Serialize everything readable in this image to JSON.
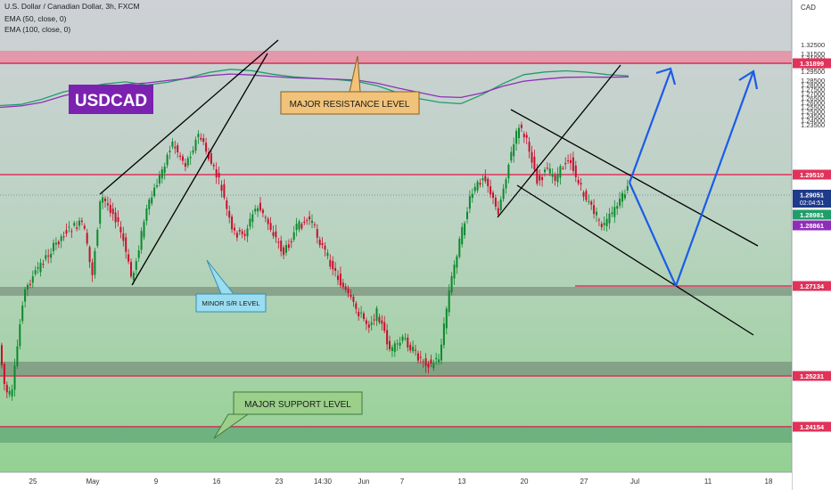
{
  "header": {
    "symbol_line": "U.S. Dollar / Canadian Dollar, 3h, FXCM",
    "ema50_line": "EMA (50, close, 0)",
    "ema100_line": "EMA (100, close, 0)",
    "currency": "CAD"
  },
  "colors": {
    "background_top": "#ced1d6",
    "background_bottom": "#93d192",
    "candle_up": "#0b8a2c",
    "candle_down": "#c8102e",
    "ema50": "#1f9e6a",
    "ema100": "#8e2eb8",
    "resistance": "#e0335a",
    "support_zone": "#6b7b6b",
    "projection": "#1a5ce8",
    "title_badge": "#7b22b0"
  },
  "chart_data": {
    "type": "candlestick",
    "title": "USDCAD",
    "price_axis": {
      "min": 1.2325,
      "max": 1.3325,
      "ticks": [
        "1.32500",
        "1.31500",
        "1.31000",
        "1.30500",
        "1.30000",
        "1.29500",
        "1.28500",
        "1.28000",
        "1.27500",
        "1.27000",
        "1.26500",
        "1.26000",
        "1.25500",
        "1.25000",
        "1.24500",
        "1.24000",
        "1.23500"
      ]
    },
    "time_axis": {
      "ticks": [
        "25",
        "May",
        "9",
        "16",
        "23",
        "14:30",
        "Jun",
        "7",
        "13",
        "20",
        "27",
        "Jul",
        "11",
        "18"
      ]
    },
    "price_labels": [
      {
        "label": "1.31899",
        "kind": "level"
      },
      {
        "label": "1.29510",
        "kind": "level"
      },
      {
        "label": "1.29051",
        "kind": "current",
        "sub": "02:04:51"
      },
      {
        "label": "1.28981",
        "kind": "ema50"
      },
      {
        "label": "1.28861",
        "kind": "ema100"
      },
      {
        "label": "1.27134",
        "kind": "level"
      },
      {
        "label": "1.25231",
        "kind": "level"
      },
      {
        "label": "1.24154",
        "kind": "level"
      }
    ],
    "series": [
      {
        "name": "EMA (50, close, 0)",
        "values": [
          1.2565,
          1.2578,
          1.2636,
          1.2716,
          1.2767,
          1.2808,
          1.2831,
          1.2796,
          1.2826,
          1.2878,
          1.2938,
          1.2972,
          1.2957,
          1.2917,
          1.2887,
          1.2872,
          1.2859,
          1.2837,
          1.2787,
          1.2707,
          1.2642,
          1.2601,
          1.2586,
          1.2687,
          1.2811,
          1.2912,
          1.2942,
          1.2955,
          1.294,
          1.2912,
          1.2898
        ]
      },
      {
        "name": "EMA (100, close, 0)",
        "values": [
          1.2545,
          1.2561,
          1.2601,
          1.2673,
          1.2728,
          1.2768,
          1.2802,
          1.2819,
          1.2846,
          1.2871,
          1.2902,
          1.2919,
          1.2908,
          1.2891,
          1.2876,
          1.2869,
          1.2861,
          1.2851,
          1.2816,
          1.2761,
          1.2713,
          1.2664,
          1.2656,
          1.2706,
          1.2783,
          1.2839,
          1.2863,
          1.2882,
          1.2885,
          1.2883,
          1.2886
        ]
      }
    ],
    "annotations": [
      {
        "text": "MAJOR RESISTANCE LEVEL"
      },
      {
        "text": "MINOR S/R LEVEL"
      },
      {
        "text": "MAJOR SUPPORT LEVEL"
      }
    ],
    "grid": false,
    "legend": "top-left"
  }
}
